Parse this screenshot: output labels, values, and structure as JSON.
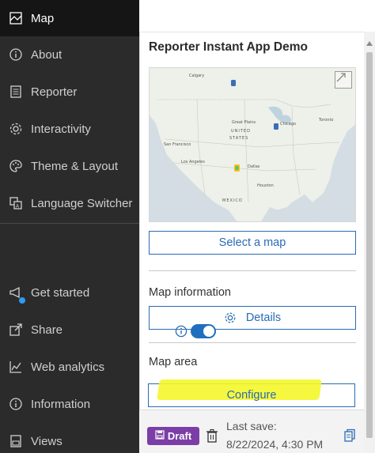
{
  "sidebar": {
    "items": [
      {
        "label": "Map",
        "icon": "map-icon",
        "active": true
      },
      {
        "label": "About",
        "icon": "info-icon"
      },
      {
        "label": "Reporter",
        "icon": "reporter-icon"
      },
      {
        "label": "Interactivity",
        "icon": "gear-icon"
      },
      {
        "label": "Theme & Layout",
        "icon": "palette-icon"
      },
      {
        "label": "Language Switcher",
        "icon": "language-icon"
      }
    ],
    "bottom_items": [
      {
        "label": "Get started",
        "icon": "megaphone-icon"
      },
      {
        "label": "Share",
        "icon": "share-icon"
      },
      {
        "label": "Web analytics",
        "icon": "analytics-icon"
      },
      {
        "label": "Information",
        "icon": "info-icon"
      },
      {
        "label": "Views",
        "icon": "views-icon"
      }
    ]
  },
  "panel": {
    "title": "Reporter Instant App Demo",
    "select_map_label": "Select a map",
    "map_information_label": "Map information",
    "details_label": "Details",
    "map_area_label": "Map area",
    "configure_label": "Configure"
  },
  "map_labels": {
    "calgary": "Calgary",
    "united": "UNITED",
    "states": "STATES",
    "chicago": "Chicago",
    "san_francisco": "San Francisco",
    "los_angeles": "Los Angeles",
    "dallas": "Dallas",
    "great_plains": "Great Plains",
    "houston": "Houston",
    "mexico": "MEXICO",
    "toronto": "Toronto"
  },
  "footer": {
    "draft_label": "Draft",
    "last_save_label": "Last save:",
    "last_save_date": "8/22/2024, 4:30 PM"
  },
  "colors": {
    "sidebar_bg": "#2b2b2b",
    "active_bg": "#151515",
    "accent_blue": "#2a6bb5",
    "draft_purple": "#7b3ea6",
    "highlight_yellow": "#f4f72a"
  }
}
